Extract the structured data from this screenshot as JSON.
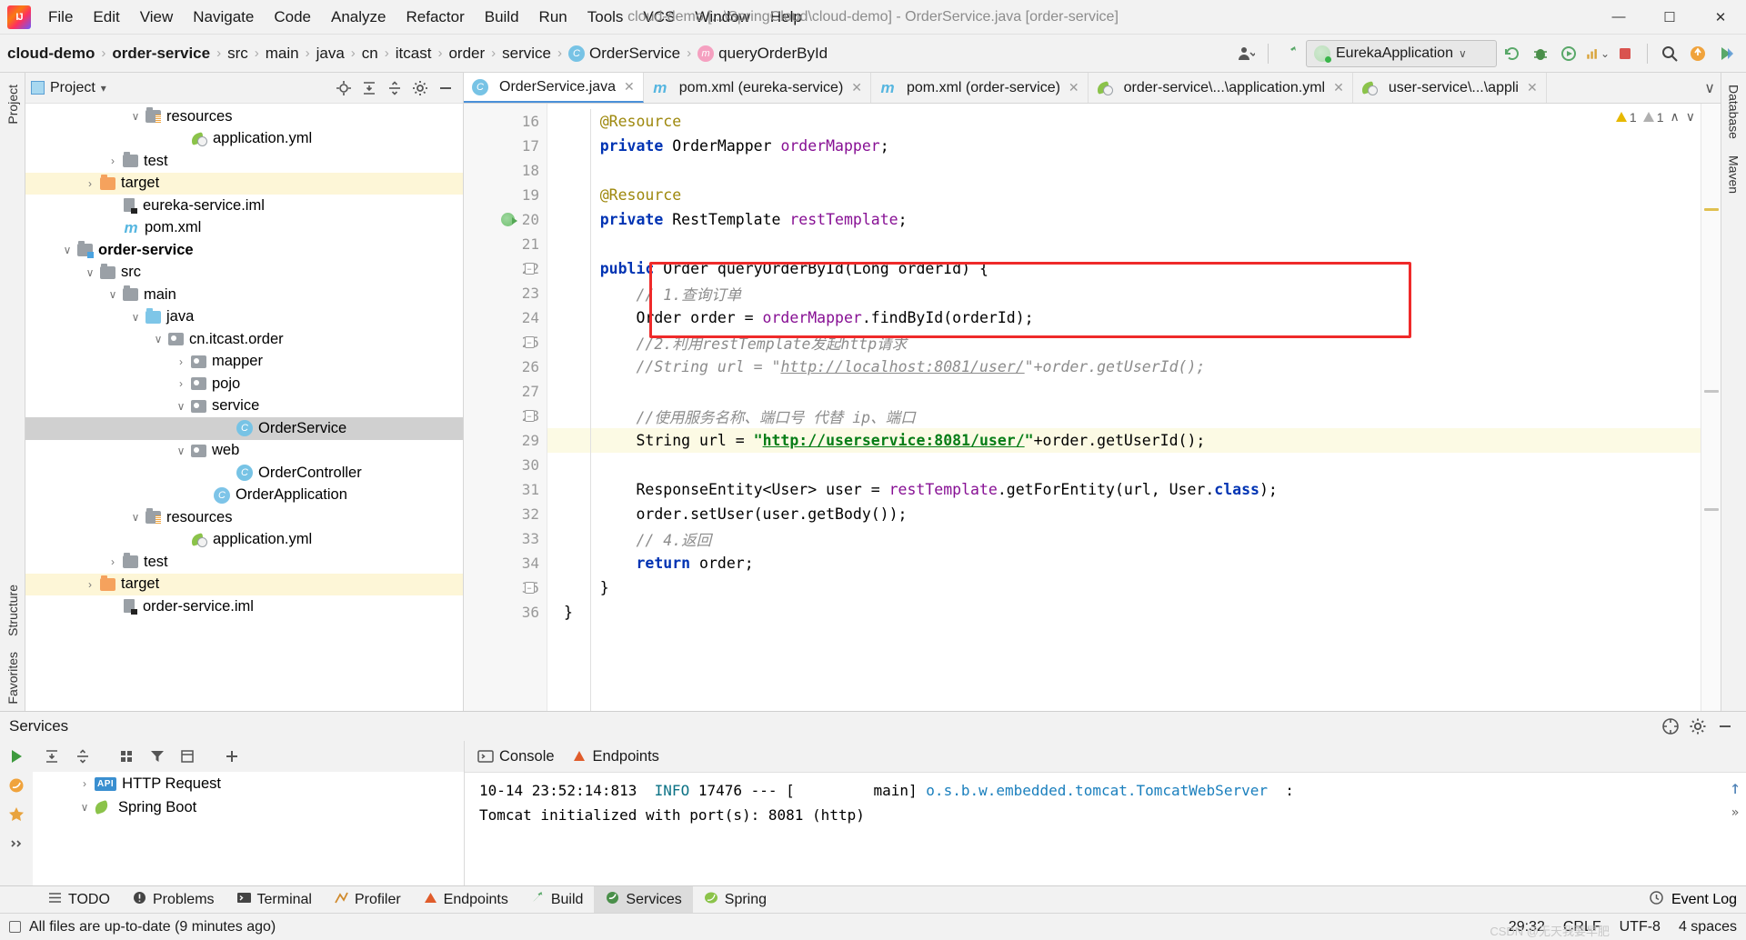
{
  "window": {
    "title": "cloud-demo [...\\SpringCloud\\cloud-demo] - OrderService.java [order-service]",
    "minimize": "—",
    "maximize": "☐",
    "close": "✕"
  },
  "menu": {
    "items": [
      "File",
      "Edit",
      "View",
      "Navigate",
      "Code",
      "Analyze",
      "Refactor",
      "Build",
      "Run",
      "Tools",
      "VCS",
      "Window",
      "Help"
    ]
  },
  "breadcrumb": {
    "items": [
      {
        "label": "cloud-demo",
        "bold": true,
        "icon": ""
      },
      {
        "label": "order-service",
        "bold": true,
        "icon": ""
      },
      {
        "label": "src",
        "bold": false,
        "icon": ""
      },
      {
        "label": "main",
        "bold": false,
        "icon": ""
      },
      {
        "label": "java",
        "bold": false,
        "icon": ""
      },
      {
        "label": "cn",
        "bold": false,
        "icon": ""
      },
      {
        "label": "itcast",
        "bold": false,
        "icon": ""
      },
      {
        "label": "order",
        "bold": false,
        "icon": ""
      },
      {
        "label": "service",
        "bold": false,
        "icon": ""
      },
      {
        "label": "OrderService",
        "bold": false,
        "icon": "class-icon"
      },
      {
        "label": "queryOrderById",
        "bold": false,
        "icon": "method-icon"
      }
    ],
    "separator": "›"
  },
  "toolbar": {
    "run_config": "EurekaApplication",
    "dropdown_caret": "∨",
    "icons": [
      "user-icon",
      "hammer-build-icon",
      "run-icon",
      "debug-icon",
      "run-coverage-icon",
      "profiler-icon",
      "stop-icon",
      "search-icon",
      "update-icon",
      "plugins-icon"
    ]
  },
  "left_tool_tabs": [
    "Project",
    "Structure",
    "Favorites"
  ],
  "right_tool_tabs": [
    "Database",
    "Maven"
  ],
  "project_panel": {
    "title": "Project",
    "dropdown_caret": "▾",
    "actions": [
      "locate-icon",
      "expand-all-icon",
      "collapse-all-icon",
      "gear-icon",
      "hide-icon"
    ],
    "tree": [
      {
        "label": "resources",
        "indent": 4,
        "arrow": "∨",
        "icon": "folder-resources",
        "state": "normal"
      },
      {
        "label": "application.yml",
        "indent": 6,
        "arrow": "",
        "icon": "yml-spring",
        "state": "normal"
      },
      {
        "label": "test",
        "indent": 3,
        "arrow": "›",
        "icon": "folder-gray",
        "state": "normal"
      },
      {
        "label": "target",
        "indent": 2,
        "arrow": "›",
        "icon": "folder-orange",
        "state": "highlight"
      },
      {
        "label": "eureka-service.iml",
        "indent": 3,
        "arrow": "",
        "icon": "iml",
        "state": "normal"
      },
      {
        "label": "pom.xml",
        "indent": 3,
        "arrow": "",
        "icon": "maven-m",
        "state": "normal"
      },
      {
        "label": "order-service",
        "indent": 1,
        "arrow": "∨",
        "icon": "folder-module",
        "state": "bold"
      },
      {
        "label": "src",
        "indent": 2,
        "arrow": "∨",
        "icon": "folder-gray",
        "state": "normal"
      },
      {
        "label": "main",
        "indent": 3,
        "arrow": "∨",
        "icon": "folder-gray",
        "state": "normal"
      },
      {
        "label": "java",
        "indent": 4,
        "arrow": "∨",
        "icon": "folder-blue",
        "state": "normal"
      },
      {
        "label": "cn.itcast.order",
        "indent": 5,
        "arrow": "∨",
        "icon": "folder-package",
        "state": "normal"
      },
      {
        "label": "mapper",
        "indent": 6,
        "arrow": "›",
        "icon": "folder-package",
        "state": "normal"
      },
      {
        "label": "pojo",
        "indent": 6,
        "arrow": "›",
        "icon": "folder-package",
        "state": "normal"
      },
      {
        "label": "service",
        "indent": 6,
        "arrow": "∨",
        "icon": "folder-package",
        "state": "normal"
      },
      {
        "label": "OrderService",
        "indent": 8,
        "arrow": "",
        "icon": "java-class",
        "state": "selected"
      },
      {
        "label": "web",
        "indent": 6,
        "arrow": "∨",
        "icon": "folder-package",
        "state": "normal"
      },
      {
        "label": "OrderController",
        "indent": 8,
        "arrow": "",
        "icon": "java-class",
        "state": "normal"
      },
      {
        "label": "OrderApplication",
        "indent": 7,
        "arrow": "",
        "icon": "spring-class",
        "state": "normal"
      },
      {
        "label": "resources",
        "indent": 4,
        "arrow": "∨",
        "icon": "folder-resources",
        "state": "normal"
      },
      {
        "label": "application.yml",
        "indent": 6,
        "arrow": "",
        "icon": "yml-spring",
        "state": "normal"
      },
      {
        "label": "test",
        "indent": 3,
        "arrow": "›",
        "icon": "folder-gray",
        "state": "normal"
      },
      {
        "label": "target",
        "indent": 2,
        "arrow": "›",
        "icon": "folder-orange",
        "state": "highlight"
      },
      {
        "label": "order-service.iml",
        "indent": 3,
        "arrow": "",
        "icon": "iml",
        "state": "normal"
      }
    ]
  },
  "editor": {
    "tabs": [
      {
        "label": "OrderService.java",
        "icon": "java-class",
        "active": true
      },
      {
        "label": "pom.xml (eureka-service)",
        "icon": "maven-m",
        "active": false
      },
      {
        "label": "pom.xml (order-service)",
        "icon": "maven-m",
        "active": false
      },
      {
        "label": "order-service\\...\\application.yml",
        "icon": "yml-spring",
        "active": false
      },
      {
        "label": "user-service\\...\\appli",
        "icon": "yml-spring",
        "active": false
      }
    ],
    "tab_overflow_caret": "∨",
    "inspection": {
      "warning_count": "1",
      "weak_warning_count": "1",
      "up_arrow": "∧",
      "down_arrow": "∨"
    },
    "lines": [
      {
        "n": "16",
        "tokens": [
          {
            "t": "    ",
            "c": "plain"
          },
          {
            "t": "@Resource",
            "c": "anno"
          }
        ]
      },
      {
        "n": "17",
        "tokens": [
          {
            "t": "    ",
            "c": "plain"
          },
          {
            "t": "private",
            "c": "kw"
          },
          {
            "t": " OrderMapper ",
            "c": "plain"
          },
          {
            "t": "orderMapper",
            "c": "field"
          },
          {
            "t": ";",
            "c": "plain"
          }
        ]
      },
      {
        "n": "18",
        "tokens": []
      },
      {
        "n": "19",
        "tokens": [
          {
            "t": "    ",
            "c": "plain"
          },
          {
            "t": "@Resource",
            "c": "anno"
          }
        ]
      },
      {
        "n": "20",
        "tokens": [
          {
            "t": "    ",
            "c": "plain"
          },
          {
            "t": "private",
            "c": "kw"
          },
          {
            "t": " RestTemplate ",
            "c": "plain"
          },
          {
            "t": "restTemplate",
            "c": "field"
          },
          {
            "t": ";",
            "c": "plain"
          }
        ],
        "gutter": "spring"
      },
      {
        "n": "21",
        "tokens": []
      },
      {
        "n": "22",
        "tokens": [
          {
            "t": "    ",
            "c": "plain"
          },
          {
            "t": "public",
            "c": "kw"
          },
          {
            "t": " Order queryOrderById(Long orderId) {",
            "c": "plain"
          }
        ],
        "gutter": "fold"
      },
      {
        "n": "23",
        "tokens": [
          {
            "t": "        ",
            "c": "plain"
          },
          {
            "t": "// 1.查询订单",
            "c": "cmt"
          }
        ]
      },
      {
        "n": "24",
        "tokens": [
          {
            "t": "        Order order = ",
            "c": "plain"
          },
          {
            "t": "orderMapper",
            "c": "field"
          },
          {
            "t": ".findById(orderId);",
            "c": "plain"
          }
        ]
      },
      {
        "n": "25",
        "tokens": [
          {
            "t": "        ",
            "c": "plain"
          },
          {
            "t": "//2.利用restTemplate发起http请求",
            "c": "cmt"
          }
        ],
        "gutter": "fold"
      },
      {
        "n": "26",
        "tokens": [
          {
            "t": "        ",
            "c": "plain"
          },
          {
            "t": "//String url = \"",
            "c": "cmt"
          },
          {
            "t": "http://localhost:8081/user/",
            "c": "cmtlink"
          },
          {
            "t": "\"+order.getUserId();",
            "c": "cmt"
          }
        ]
      },
      {
        "n": "27",
        "tokens": []
      },
      {
        "n": "28",
        "tokens": [
          {
            "t": "        ",
            "c": "plain"
          },
          {
            "t": "//使用服务名称、端口号 代替 ip、端口",
            "c": "cmt"
          }
        ],
        "gutter": "fold"
      },
      {
        "n": "29",
        "tokens": [
          {
            "t": "        String url = ",
            "c": "plain"
          },
          {
            "t": "\"",
            "c": "str"
          },
          {
            "t": "http://userservice:8081/user/",
            "c": "strlink"
          },
          {
            "t": "\"",
            "c": "str"
          },
          {
            "t": "+order.getUserId();",
            "c": "plain"
          }
        ],
        "current": true
      },
      {
        "n": "30",
        "tokens": []
      },
      {
        "n": "31",
        "tokens": [
          {
            "t": "        ResponseEntity<User> user = ",
            "c": "plain"
          },
          {
            "t": "restTemplate",
            "c": "field"
          },
          {
            "t": ".getForEntity(url, User.",
            "c": "plain"
          },
          {
            "t": "class",
            "c": "kw"
          },
          {
            "t": ");",
            "c": "plain"
          }
        ]
      },
      {
        "n": "32",
        "tokens": [
          {
            "t": "        order.setUser(user.getBody());",
            "c": "plain"
          }
        ]
      },
      {
        "n": "33",
        "tokens": [
          {
            "t": "        ",
            "c": "plain"
          },
          {
            "t": "// 4.返回",
            "c": "cmt"
          }
        ]
      },
      {
        "n": "34",
        "tokens": [
          {
            "t": "        ",
            "c": "plain"
          },
          {
            "t": "return",
            "c": "kw"
          },
          {
            "t": " order;",
            "c": "plain"
          }
        ]
      },
      {
        "n": "35",
        "tokens": [
          {
            "t": "    }",
            "c": "plain"
          }
        ],
        "gutter": "fold"
      },
      {
        "n": "36",
        "tokens": [
          {
            "t": "}",
            "c": "plain"
          }
        ]
      }
    ]
  },
  "services": {
    "title": "Services",
    "header_actions": [
      "help-icon",
      "gear-icon",
      "hide-icon"
    ],
    "toolbar_icons": [
      "run-icon",
      "expand-icon",
      "collapse-icon",
      "group-icon",
      "filter-icon",
      "add-tab-icon",
      "add-icon"
    ],
    "tree": [
      {
        "label": "HTTP Request",
        "icon": "api",
        "arrow": "›",
        "indent": 1
      },
      {
        "label": "Spring Boot",
        "icon": "spring",
        "arrow": "∨",
        "indent": 1
      }
    ],
    "tabs": [
      {
        "label": "Console",
        "icon": "console-icon",
        "active": true
      },
      {
        "label": "Endpoints",
        "icon": "endpoints-icon",
        "active": false
      }
    ],
    "console": [
      {
        "parts": [
          {
            "t": "10-14 23:52:14:813 ",
            "c": "c-ts"
          },
          {
            "t": " INFO ",
            "c": "c-info"
          },
          {
            "t": "17476",
            "c": "c-pid"
          },
          {
            "t": " --- [         main] ",
            "c": "c-ts"
          },
          {
            "t": "o.s.b.w.embedded.tomcat.TomcatWebServer",
            "c": "c-logger"
          },
          {
            "t": "  : ",
            "c": "c-ts"
          }
        ]
      },
      {
        "parts": [
          {
            "t": "Tomcat initialized with port(s): 8081 (http)",
            "c": "c-ts"
          }
        ]
      }
    ],
    "console_scroll_up": "↑"
  },
  "bottom_tabs": [
    {
      "label": "TODO",
      "icon": "todo-icon",
      "active": false
    },
    {
      "label": "Problems",
      "icon": "problems-icon",
      "active": false
    },
    {
      "label": "Terminal",
      "icon": "terminal-icon",
      "active": false
    },
    {
      "label": "Profiler",
      "icon": "profiler-icon",
      "active": false
    },
    {
      "label": "Endpoints",
      "icon": "endpoints-icon",
      "active": false
    },
    {
      "label": "Build",
      "icon": "build-icon",
      "active": false
    },
    {
      "label": "Services",
      "icon": "services-icon",
      "active": true
    },
    {
      "label": "Spring",
      "icon": "spring-icon",
      "active": false
    }
  ],
  "bottom_right": {
    "event_log": "Event Log"
  },
  "statusbar": {
    "message": "All files are up-to-date (9 minutes ago)",
    "caret": "29:32",
    "line_sep": "CRLF",
    "encoding": "UTF-8",
    "indent": "4 spaces",
    "watermark": "CSDN @无天我要早肥"
  }
}
